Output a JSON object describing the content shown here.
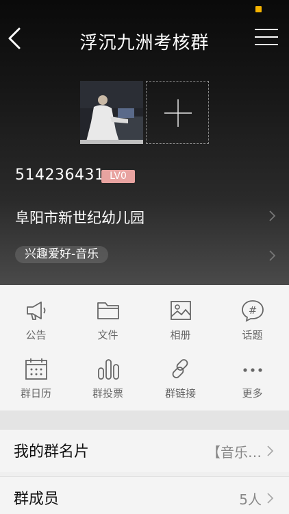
{
  "header": {
    "title": "浮沉九洲考核群"
  },
  "group": {
    "id": "514236431",
    "level": "LV0",
    "location": "阜阳市新世纪幼儿园",
    "tag": "兴趣爱好-音乐"
  },
  "actions": [
    {
      "label": "公告",
      "icon": "megaphone-icon"
    },
    {
      "label": "文件",
      "icon": "folder-icon"
    },
    {
      "label": "相册",
      "icon": "photo-album-icon"
    },
    {
      "label": "话题",
      "icon": "hashtag-icon"
    },
    {
      "label": "群日历",
      "icon": "calendar-icon"
    },
    {
      "label": "群投票",
      "icon": "vote-icon"
    },
    {
      "label": "群链接",
      "icon": "link-icon"
    },
    {
      "label": "更多",
      "icon": "more-icon"
    }
  ],
  "settings": [
    {
      "label": "我的群名片",
      "value": "【音乐…"
    },
    {
      "label": "群成员",
      "value": "5人"
    }
  ],
  "colors": {
    "accent_status": "#f5b300",
    "badge": "#e8a3a0"
  }
}
